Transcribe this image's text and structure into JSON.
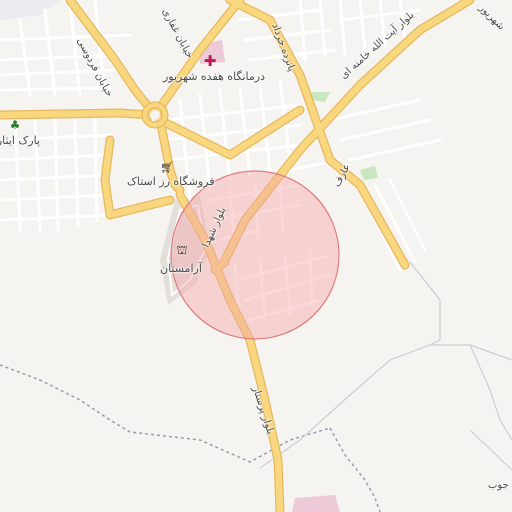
{
  "map": {
    "labels": {
      "clinic": "درمانگاه هفده شهریور",
      "store": "فروشگاه رز استاک",
      "cemetery": "آرامستان",
      "park": "پارک ایثار",
      "khamenei_blvd": "بلوار آیت الله خامنه ای",
      "shohada_blvd": "بلوار شهدا",
      "parastar_blvd": "بلوار پرستار",
      "aref": "عارف",
      "khordad15": "پانزده خرداد",
      "ferdowsi": "خیابان فردوسی",
      "ghaffari": "خیابان غفاری",
      "shahrivar": "شهریور",
      "bottom_right": "جوب"
    },
    "colors": {
      "background": "#f6f4f0",
      "major_road": "#f8d77e",
      "major_road_casing": "#e8b860",
      "minor_road": "#ffffff",
      "circle_fill": "#f4a6a8",
      "circle_stroke": "#e07c80",
      "cemetery_fill": "#dcd7d2",
      "park_green": "#c8e6c0",
      "hospital_pink": "#e8b8cc"
    },
    "icons": {
      "clinic": "hospital-cross-icon",
      "store": "shopping-cart-icon",
      "cemetery": "cemetery-icon",
      "park": "tree-icon"
    }
  }
}
